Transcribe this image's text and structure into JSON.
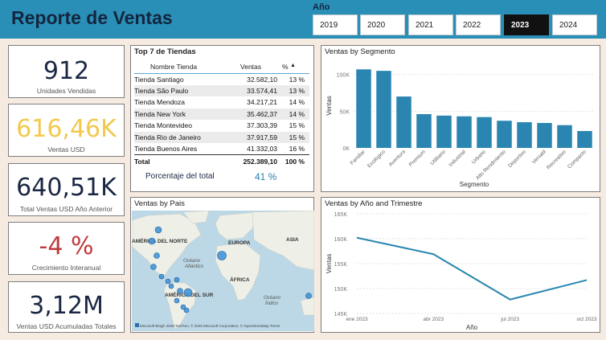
{
  "header": {
    "title": "Reporte de Ventas",
    "year_label": "Año",
    "years": [
      "2019",
      "2020",
      "2021",
      "2022",
      "2023",
      "2024"
    ],
    "selected_year": "2023"
  },
  "kpis": {
    "units": {
      "value": "912",
      "label": "Unidades Vendidas"
    },
    "sales": {
      "value": "616,46K",
      "label": "Ventas USD"
    },
    "prev": {
      "value": "640,51K",
      "label": "Total Ventas USD Año Anterior"
    },
    "growth": {
      "value": "-4 %",
      "label": "Crecimiento Interanual"
    },
    "accum": {
      "value": "3,12M",
      "label": "Ventas USD Acumuladas Totales"
    }
  },
  "top7": {
    "title": "Top 7 de Tiendas",
    "columns": [
      "Nombre Tienda",
      "Ventas",
      "%"
    ],
    "rows": [
      [
        "Tienda Santiago",
        "32.582,10",
        "13 %"
      ],
      [
        "Tienda São Paulo",
        "33.574,41",
        "13 %"
      ],
      [
        "Tienda Mendoza",
        "34.217,21",
        "14 %"
      ],
      [
        "Tienda New York",
        "35.462,37",
        "14 %"
      ],
      [
        "Tienda Montevideo",
        "37.303,39",
        "15 %"
      ],
      [
        "Tienda Rio de Janeiro",
        "37.917,59",
        "15 %"
      ],
      [
        "Tienda Buenos Aires",
        "41.332,03",
        "16 %"
      ]
    ],
    "total": [
      "Total",
      "252.389,10",
      "100 %"
    ],
    "pct_label": "Porcentaje del total",
    "pct_value": "41 %"
  },
  "map": {
    "title": "Ventas by Pais",
    "labels": [
      "AMÉRICA DEL NORTE",
      "EUROPA",
      "ASIA",
      "Océano Atlántico",
      "ÁFRICA",
      "AMÉRICA DEL SUR",
      "Océano Índico"
    ],
    "attribution": "© 2025 TomTom, © 2025 Microsoft Corporation, © OpenStreetMap  Terms",
    "logo": "Microsoft Bing"
  },
  "chart_data": [
    {
      "type": "bar",
      "title": "Ventas by Segmento",
      "xlabel": "Segmento",
      "ylabel": "Ventas",
      "categories": [
        "Familiar",
        "Ecológico",
        "Aventura",
        "Premium",
        "Utilitario",
        "Industrial",
        "Urbano",
        "Alto Rendimiento",
        "Deportivo",
        "Versatil",
        "Recreativo",
        "Compacto"
      ],
      "values": [
        107000,
        105000,
        70000,
        46000,
        44000,
        43000,
        42000,
        37000,
        35000,
        34000,
        31000,
        23000
      ],
      "ylim": [
        0,
        115000
      ],
      "yticks": [
        "0K",
        "50K",
        "100K"
      ],
      "color": "#2a86b0"
    },
    {
      "type": "line",
      "title": "Ventas by Año and Trimestre",
      "xlabel": "Año",
      "ylabel": "Ventas",
      "categories": [
        "ene 2023",
        "abr 2023",
        "jul 2023",
        "oct 2023"
      ],
      "values": [
        160200,
        156900,
        147800,
        151700
      ],
      "ylim": [
        145000,
        165000
      ],
      "yticks": [
        "145K",
        "150K",
        "155K",
        "160K",
        "165K"
      ],
      "color": "#2a86b0"
    }
  ],
  "colors": {
    "header": "#2a8fb7",
    "accent_yellow": "#f2c94c",
    "negative": "#c0393b",
    "navy": "#1a2744"
  }
}
